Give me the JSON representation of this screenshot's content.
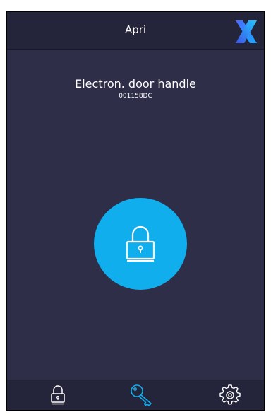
{
  "header": {
    "title": "Apri",
    "logo": "x-logo-icon"
  },
  "device": {
    "name": "Electron. door handle",
    "id": "001158DC"
  },
  "lock_button": {
    "icon": "padlock-icon",
    "color": "#11aeed"
  },
  "nav": {
    "items": [
      {
        "icon": "padlock-icon",
        "active": false
      },
      {
        "icon": "key-icon",
        "active": true
      },
      {
        "icon": "settings-gear-icon",
        "active": false
      }
    ]
  },
  "colors": {
    "background": "#2e2e48",
    "header": "#24243b",
    "accent": "#11aeed",
    "text": "#ffffff"
  }
}
